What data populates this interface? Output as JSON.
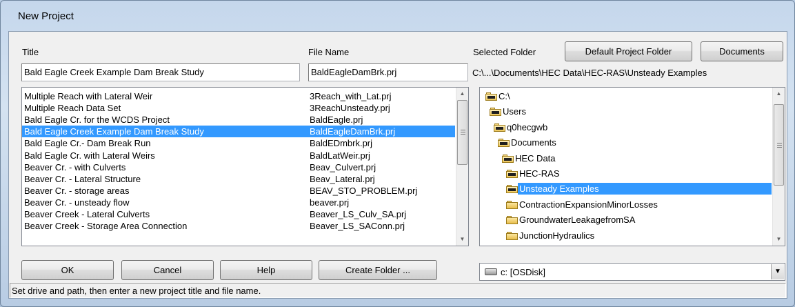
{
  "window": {
    "title": "New Project"
  },
  "labels": {
    "title": "Title",
    "file_name": "File Name",
    "selected_folder": "Selected Folder"
  },
  "buttons": {
    "default_project_folder": "Default Project Folder",
    "documents": "Documents",
    "ok": "OK",
    "cancel": "Cancel",
    "help": "Help",
    "create_folder": "Create Folder ..."
  },
  "fields": {
    "title_value": "Bald Eagle Creek Example Dam Break Study",
    "file_name_value": "BaldEagleDamBrk.prj",
    "selected_folder_path": "C:\\...\\Documents\\HEC Data\\HEC-RAS\\Unsteady Examples"
  },
  "projects": [
    {
      "title": "Multiple Reach with Lateral Weir",
      "file": "3Reach_with_Lat.prj"
    },
    {
      "title": "Multiple Reach Data Set",
      "file": "3ReachUnsteady.prj"
    },
    {
      "title": "Bald Eagle Cr. for the WCDS Project",
      "file": "BaldEagle.prj"
    },
    {
      "title": "Bald Eagle Creek Example Dam Break Study",
      "file": "BaldEagleDamBrk.prj",
      "selected": true
    },
    {
      "title": "Bald Eagle Cr.- Dam Break Run",
      "file": "BaldEDmbrk.prj"
    },
    {
      "title": "Bald Eagle Cr. with Lateral Weirs",
      "file": "BaldLatWeir.prj"
    },
    {
      "title": "Beaver Cr. - with Culverts",
      "file": "Beav_Culvert.prj"
    },
    {
      "title": "Beaver Cr. - Lateral Structure",
      "file": "Beav_Lateral.prj"
    },
    {
      "title": "Beaver Cr. - storage areas",
      "file": "BEAV_STO_PROBLEM.prj"
    },
    {
      "title": "Beaver Cr. - unsteady flow",
      "file": "beaver.prj"
    },
    {
      "title": "Beaver Creek - Lateral Culverts",
      "file": "Beaver_LS_Culv_SA.prj"
    },
    {
      "title": "Beaver Creek - Storage Area Connection",
      "file": "Beaver_LS_SAConn.prj"
    }
  ],
  "folders": [
    {
      "name": "C:\\",
      "open": true
    },
    {
      "name": "Users",
      "open": true
    },
    {
      "name": "q0hecgwb",
      "open": true
    },
    {
      "name": "Documents",
      "open": true
    },
    {
      "name": "HEC Data",
      "open": true
    },
    {
      "name": "HEC-RAS",
      "open": true
    },
    {
      "name": "Unsteady Examples",
      "open": true,
      "selected": true
    },
    {
      "name": "ContractionExpansionMinorLosses",
      "open": false
    },
    {
      "name": "GroundwaterLeakagefromSA",
      "open": false
    },
    {
      "name": "JunctionHydraulics",
      "open": false
    }
  ],
  "drive": {
    "selected": "c: [OSDisk]"
  },
  "status": {
    "text": "Set drive and path, then enter a new project title and file name."
  },
  "colors": {
    "selection": "#3399ff",
    "client_bg": "#f0f0f0"
  }
}
